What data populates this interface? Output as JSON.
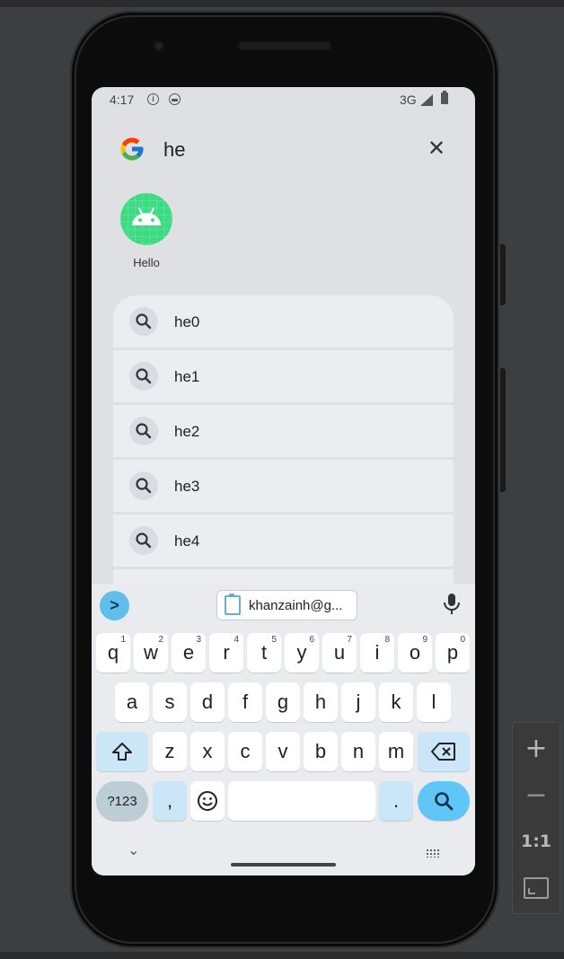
{
  "status_bar": {
    "time": "4:17",
    "network": "3G"
  },
  "search": {
    "query": "he",
    "close_glyph": "✕"
  },
  "app_result": {
    "label": "Hello",
    "icon": "android-icon",
    "color": "#3ddc84"
  },
  "suggestions": [
    {
      "text": "he0"
    },
    {
      "text": "he1"
    },
    {
      "text": "he2"
    },
    {
      "text": "he3"
    },
    {
      "text": "he4"
    }
  ],
  "keyboard": {
    "clipboard_suggestion": "khanzainh@g...",
    "expand_glyph": ">",
    "row1": [
      {
        "label": "q",
        "hint": "1"
      },
      {
        "label": "w",
        "hint": "2"
      },
      {
        "label": "e",
        "hint": "3"
      },
      {
        "label": "r",
        "hint": "4"
      },
      {
        "label": "t",
        "hint": "5"
      },
      {
        "label": "y",
        "hint": "6"
      },
      {
        "label": "u",
        "hint": "7"
      },
      {
        "label": "i",
        "hint": "8"
      },
      {
        "label": "o",
        "hint": "9"
      },
      {
        "label": "p",
        "hint": "0"
      }
    ],
    "row2": [
      "a",
      "s",
      "d",
      "f",
      "g",
      "h",
      "j",
      "k",
      "l"
    ],
    "row3": [
      "z",
      "x",
      "c",
      "v",
      "b",
      "n",
      "m"
    ],
    "symbols_label": "?123",
    "comma_label": ",",
    "period_label": ".",
    "accent": "#5fc6f7"
  },
  "emulator_toolbar": {
    "zoom_in": "+",
    "zoom_out": "−",
    "actual_size": "1:1"
  }
}
